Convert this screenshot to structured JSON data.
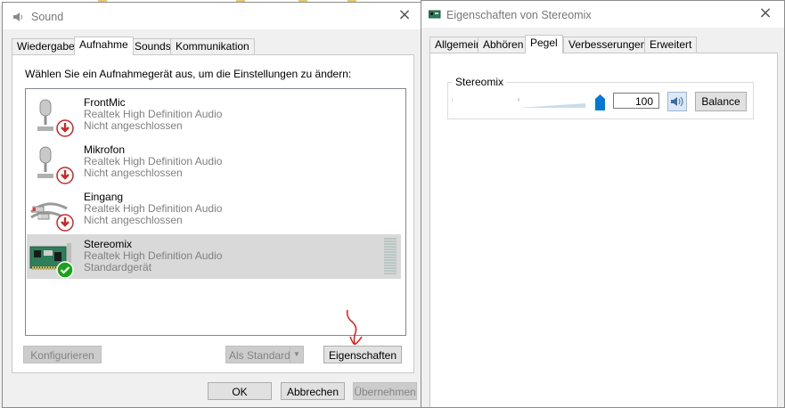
{
  "sound_window": {
    "title": "Sound",
    "tabs": [
      {
        "label": "Wiedergabe"
      },
      {
        "label": "Aufnahme"
      },
      {
        "label": "Sounds"
      },
      {
        "label": "Kommunikation"
      }
    ],
    "active_tab": "Aufnahme",
    "instruction": "Wählen Sie ein Aufnahmegerät aus, um die Einstellungen zu ändern:",
    "devices": [
      {
        "name": "FrontMic",
        "driver": "Realtek High Definition Audio",
        "status": "Nicht angeschlossen",
        "icon": "microphone-icon"
      },
      {
        "name": "Mikrofon",
        "driver": "Realtek High Definition Audio",
        "status": "Nicht angeschlossen",
        "icon": "microphone-icon"
      },
      {
        "name": "Eingang",
        "driver": "Realtek High Definition Audio",
        "status": "Nicht angeschlossen",
        "icon": "cable-icon"
      },
      {
        "name": "Stereomix",
        "driver": "Realtek High Definition Audio",
        "status": "Standardgerät",
        "icon": "circuit-board-icon",
        "selected": true
      }
    ],
    "buttons": {
      "configure": "Konfigurieren",
      "set_default": "Als Standard",
      "properties": "Eigenschaften",
      "ok": "OK",
      "cancel": "Abbrechen",
      "apply": "Übernehmen"
    }
  },
  "props_window": {
    "title": "Eigenschaften von Stereomix",
    "tabs": [
      {
        "label": "Allgemein"
      },
      {
        "label": "Abhören"
      },
      {
        "label": "Pegel"
      },
      {
        "label": "Verbesserungen"
      },
      {
        "label": "Erweitert"
      }
    ],
    "active_tab": "Pegel",
    "level_group_label": "Stereomix",
    "level_value": "100",
    "level_percent": 100,
    "balance_button": "Balance"
  },
  "colors": {
    "accent": "#0078d7",
    "selection": "#d9d9d9",
    "annotation_red": "#e01818",
    "status_ok": "#1aa31a",
    "status_disconnected": "#c62828"
  }
}
